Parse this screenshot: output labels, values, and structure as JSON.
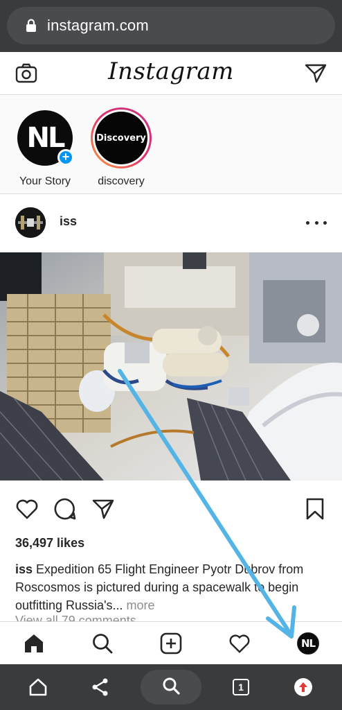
{
  "browser": {
    "url": "instagram.com",
    "tab_count": "1"
  },
  "header": {
    "logo": "Instagram",
    "icons": [
      "camera-icon",
      "direct-message-icon"
    ]
  },
  "stories": [
    {
      "label": "Your Story",
      "avatar_text": "NL",
      "has_add": true
    },
    {
      "label": "discovery",
      "avatar_text": "Discovery",
      "has_ring": true
    }
  ],
  "post": {
    "username": "iss",
    "likes": "36,497 likes",
    "caption_user": "iss",
    "caption_text": " Expedition 65 Flight Engineer Pyotr Dubrov from Roscosmos is pictured during a spacewalk to begin outfitting Russia's...",
    "caption_more": " more",
    "view_comments": "View all 79 comments"
  },
  "bottom_nav": {
    "items": [
      "home-icon",
      "search-icon",
      "new-post-icon",
      "activity-heart-icon",
      "profile-avatar"
    ],
    "avatar_text": "NL"
  },
  "colors": {
    "browser_bg": "#3a3b3d",
    "accent_blue": "#0095f6",
    "annotation_arrow": "#55b4e6"
  }
}
